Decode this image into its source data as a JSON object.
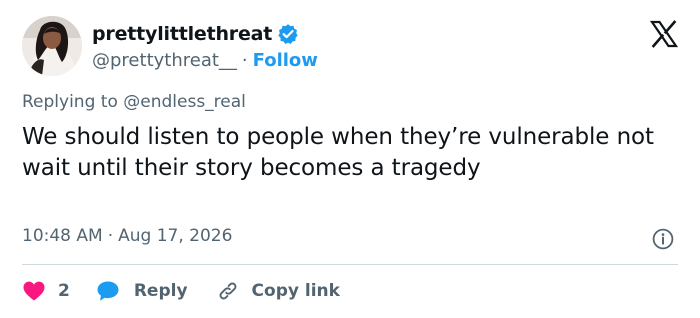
{
  "author": {
    "display_name": "prettylittlethreat",
    "handle": "@prettythreat__",
    "separator": "·",
    "follow_label": "Follow",
    "verified": true
  },
  "brand": {
    "logo_icon": "x-logo-icon"
  },
  "reply_context": {
    "prefix": "Replying to",
    "mention": "@endless_real"
  },
  "tweet": {
    "text": "We should listen to people when they’re vulnerable not wait until their story becomes a tragedy",
    "time": "10:48 AM",
    "date": "Aug 17, 2026",
    "separator": "·"
  },
  "actions": {
    "like_count": "2",
    "reply_label": "Reply",
    "copy_label": "Copy link"
  },
  "colors": {
    "accent": "#1d9bf0",
    "like": "#f91880",
    "text": "#0f1419",
    "muted": "#536471",
    "divider": "#cfd9de"
  }
}
